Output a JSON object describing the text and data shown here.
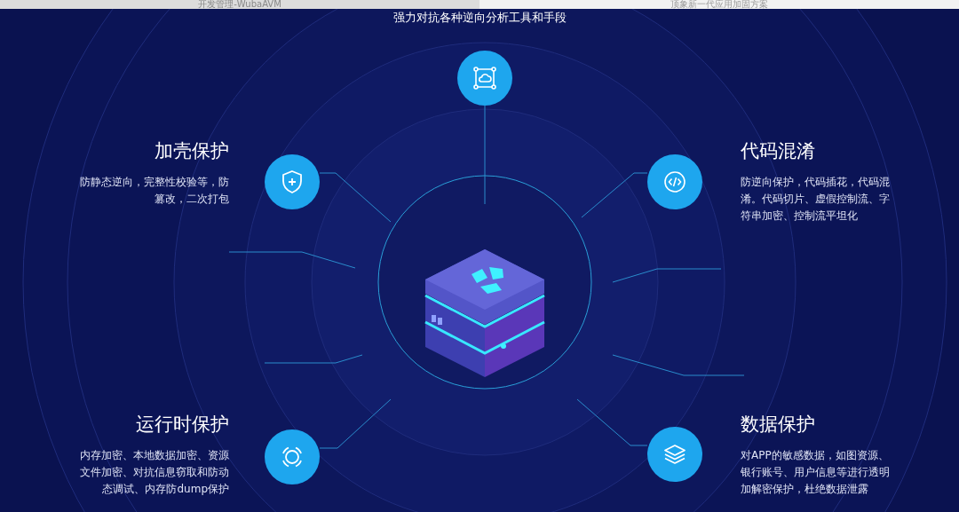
{
  "top_bar": [
    {
      "label": "开发管理-WubaAVM",
      "selected": true
    },
    {
      "label": "顶象新一代应用加固方案",
      "selected": false
    }
  ],
  "subtitle": "强力对抗各种逆向分析工具和手段",
  "hub": {
    "kind": "cloud"
  },
  "features": [
    {
      "kind": "shield",
      "title": "加壳保护",
      "description_lines": [
        "防静态逆向，完整性校验等，防",
        "篡改，二次打包"
      ]
    },
    {
      "kind": "code",
      "title": "代码混淆",
      "description_lines": [
        "防逆向保护，代码插花，代码混",
        "淆。代码切片、虚假控制流、字",
        "符串加密、控制流平坦化"
      ]
    },
    {
      "kind": "ring",
      "title": "运行时保护",
      "description_lines": [
        "内存加密、本地数据加密、资源",
        "文件加密、对抗信息窃取和防动",
        "态调试、内存防dump保护"
      ]
    },
    {
      "kind": "layers",
      "title": "数据保护",
      "description_lines": [
        "对APP的敏感数据，如图资源、",
        "银行账号、用户信息等进行透明",
        "加解密保护，杜绝数据泄露"
      ]
    }
  ]
}
